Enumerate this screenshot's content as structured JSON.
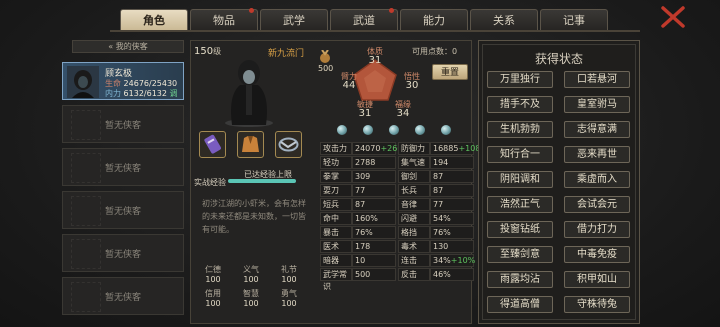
{
  "tabs": [
    {
      "label": "角色",
      "active": true,
      "dot": false
    },
    {
      "label": "物品",
      "active": false,
      "dot": true
    },
    {
      "label": "武学",
      "active": false,
      "dot": false
    },
    {
      "label": "武道",
      "active": false,
      "dot": true
    },
    {
      "label": "能力",
      "active": false,
      "dot": false
    },
    {
      "label": "关系",
      "active": false,
      "dot": false
    },
    {
      "label": "记事",
      "active": false,
      "dot": false
    }
  ],
  "sidebar": {
    "header": "我的侠客",
    "hero": {
      "name": "顾玄极",
      "hp_label": "生命",
      "hp": "24676/25430",
      "mp_label": "内力",
      "mp": "6132/6132",
      "mp_tag": "调"
    },
    "empty_label": "暂无侠客"
  },
  "profile": {
    "level": "150",
    "level_unit": "级",
    "sect": "新九流门",
    "medal_value": "500",
    "available_points_label": "可用点数：",
    "available_points": "0",
    "reset_label": "重置",
    "exp_label": "实战经验",
    "exp_status": "已达经验上限",
    "exp_fraction": 1.0,
    "description": "初涉江湖的小虾米，会有怎样的未来还都是未知数，一切皆有可能。"
  },
  "pentagon": {
    "top": {
      "label": "体质",
      "value": "31"
    },
    "left": {
      "label": "臂力",
      "value": "44"
    },
    "right": {
      "label": "悟性",
      "value": "30"
    },
    "bottom_left": {
      "label": "敏捷",
      "value": "31"
    },
    "bottom_right": {
      "label": "福缘",
      "value": "34"
    }
  },
  "virtues": [
    {
      "label": "仁德",
      "value": "100"
    },
    {
      "label": "义气",
      "value": "100"
    },
    {
      "label": "礼节",
      "value": "100"
    },
    {
      "label": "信用",
      "value": "100"
    },
    {
      "label": "智慧",
      "value": "100"
    },
    {
      "label": "勇气",
      "value": "100"
    }
  ],
  "attributes": [
    [
      {
        "k": "攻击力",
        "v": "24070",
        "bonus": "+2604"
      },
      {
        "k": "防御力",
        "v": "16885",
        "bonus": "+1080"
      }
    ],
    [
      {
        "k": "轻功",
        "v": "2788",
        "bonus": ""
      },
      {
        "k": "集气速度",
        "v": "194",
        "bonus": ""
      }
    ],
    [
      {
        "k": "拳掌",
        "v": "309",
        "bonus": ""
      },
      {
        "k": "御剑",
        "v": "87",
        "bonus": ""
      }
    ],
    [
      {
        "k": "耍刀",
        "v": "77",
        "bonus": ""
      },
      {
        "k": "长兵",
        "v": "87",
        "bonus": ""
      }
    ],
    [
      {
        "k": "短兵",
        "v": "87",
        "bonus": ""
      },
      {
        "k": "音律",
        "v": "77",
        "bonus": ""
      }
    ],
    [
      {
        "k": "命中",
        "v": "160%",
        "bonus": ""
      },
      {
        "k": "闪避",
        "v": "54%",
        "bonus": ""
      }
    ],
    [
      {
        "k": "暴击",
        "v": "76%",
        "bonus": ""
      },
      {
        "k": "格挡",
        "v": "76%",
        "bonus": ""
      }
    ],
    [
      {
        "k": "医术",
        "v": "178",
        "bonus": ""
      },
      {
        "k": "毒术",
        "v": "130",
        "bonus": ""
      }
    ],
    [
      {
        "k": "暗器",
        "v": "10",
        "bonus": ""
      },
      {
        "k": "连击",
        "v": "34%",
        "bonus": "+10%"
      }
    ],
    [
      {
        "k": "武学常识",
        "v": "500",
        "bonus": ""
      },
      {
        "k": "反击",
        "v": "46%",
        "bonus": ""
      }
    ]
  ],
  "status_panel": {
    "title": "获得状态",
    "items": [
      "万里独行",
      "口若悬河",
      "措手不及",
      "皇室驸马",
      "生机勃勃",
      "志得意满",
      "知行合一",
      "恶来再世",
      "阴阳调和",
      "乘虚而入",
      "浩然正气",
      "会试会元",
      "投窗钻纸",
      "借力打力",
      "至臻剑意",
      "中毒免疫",
      "雨露均沾",
      "积甲如山",
      "得道高僧",
      "守株待兔"
    ]
  },
  "colors": {
    "accent_gold": "#c9b893",
    "hp_green": "#5ec25e",
    "exp_teal": "#5bc5b5",
    "sect_orange": "#d8a046"
  }
}
